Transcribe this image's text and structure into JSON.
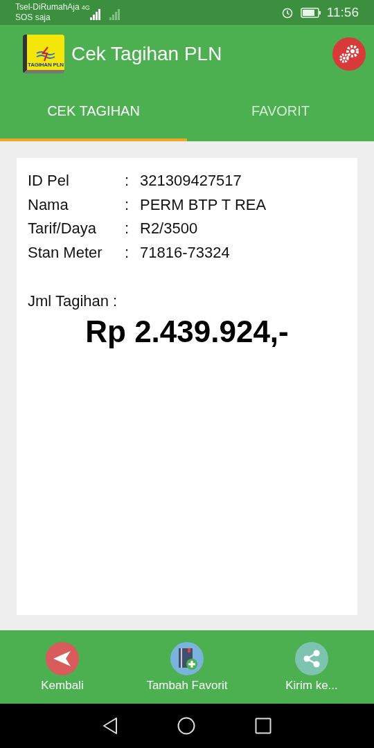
{
  "status_bar": {
    "carrier": "Tsel-DiRumahAja",
    "carrier_2": "SOS saja",
    "network": "4G",
    "time": "11:56"
  },
  "app_bar": {
    "logo_text": "TAGIHAN PLN",
    "title": "Cek Tagihan PLN"
  },
  "tabs": [
    {
      "label": "CEK TAGIHAN",
      "selected": true
    },
    {
      "label": "FAVORIT",
      "selected": false
    }
  ],
  "details": [
    {
      "label": "ID Pel",
      "separator": ":",
      "value": "321309427517"
    },
    {
      "label": "Nama",
      "separator": ":",
      "value": "PERM BTP T REA"
    },
    {
      "label": "Tarif/Daya",
      "separator": ":",
      "value": "R2/3500"
    },
    {
      "label": "Stan Meter",
      "separator": ":",
      "value": "71816-73324"
    }
  ],
  "bill": {
    "label": "Jml Tagihan :",
    "amount": "Rp 2.439.924,-"
  },
  "actions": [
    {
      "kind": "back",
      "label": "Kembali"
    },
    {
      "kind": "favorite",
      "label": "Tambah Favorit"
    },
    {
      "kind": "share",
      "label": "Kirim ke..."
    }
  ]
}
